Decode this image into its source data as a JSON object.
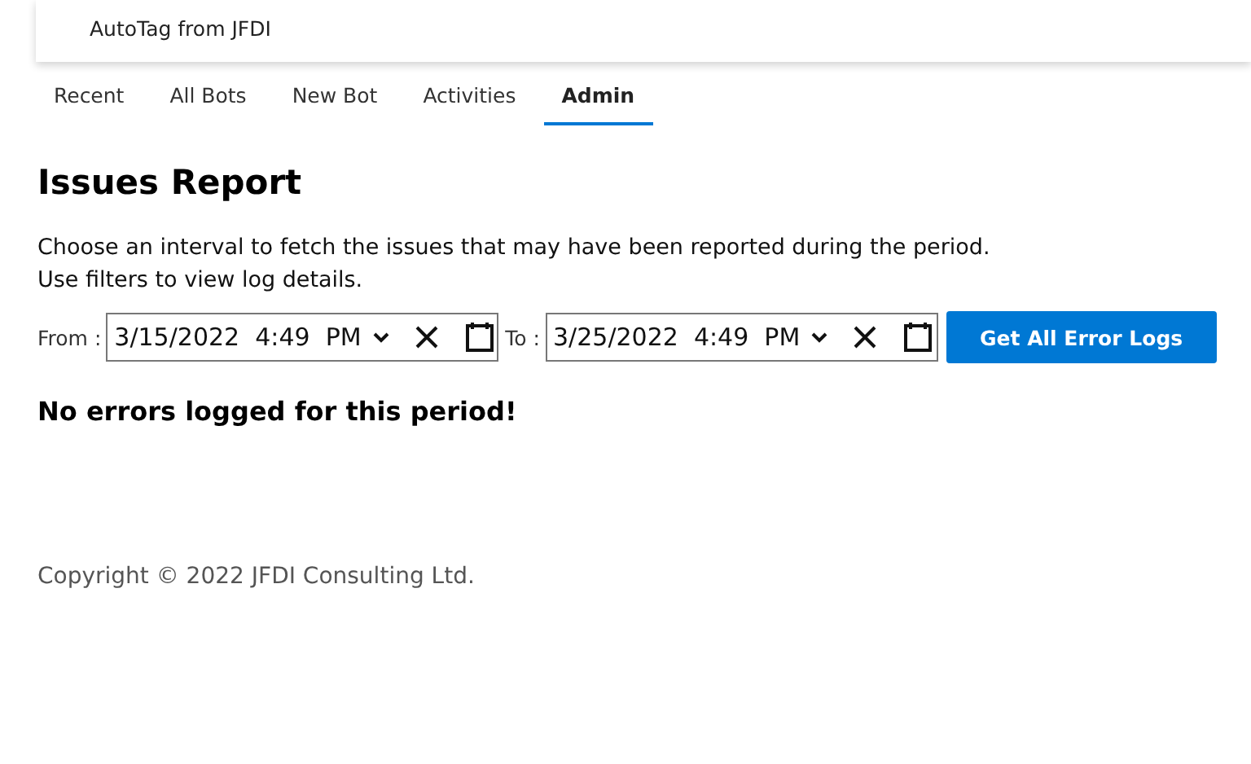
{
  "header": {
    "title": "AutoTag from JFDI"
  },
  "tabs": [
    {
      "label": "Recent",
      "selected": false
    },
    {
      "label": "All Bots",
      "selected": false
    },
    {
      "label": "New Bot",
      "selected": false
    },
    {
      "label": "Activities",
      "selected": false
    },
    {
      "label": "Admin",
      "selected": true
    }
  ],
  "heading": "Issues Report",
  "description": [
    "Choose an interval to fetch the issues that may have been reported during the period.",
    "Use filters to view log details."
  ],
  "filters": [
    {
      "label": "From :",
      "value": "3/15/2022  4:49  PM"
    },
    {
      "label": "To :",
      "value": "3/25/2022  4:49  PM"
    }
  ],
  "button": "Get All Error Logs",
  "message": "No errors logged for this period!",
  "footer": "Copyright © 2022 JFDI Consulting Ltd."
}
